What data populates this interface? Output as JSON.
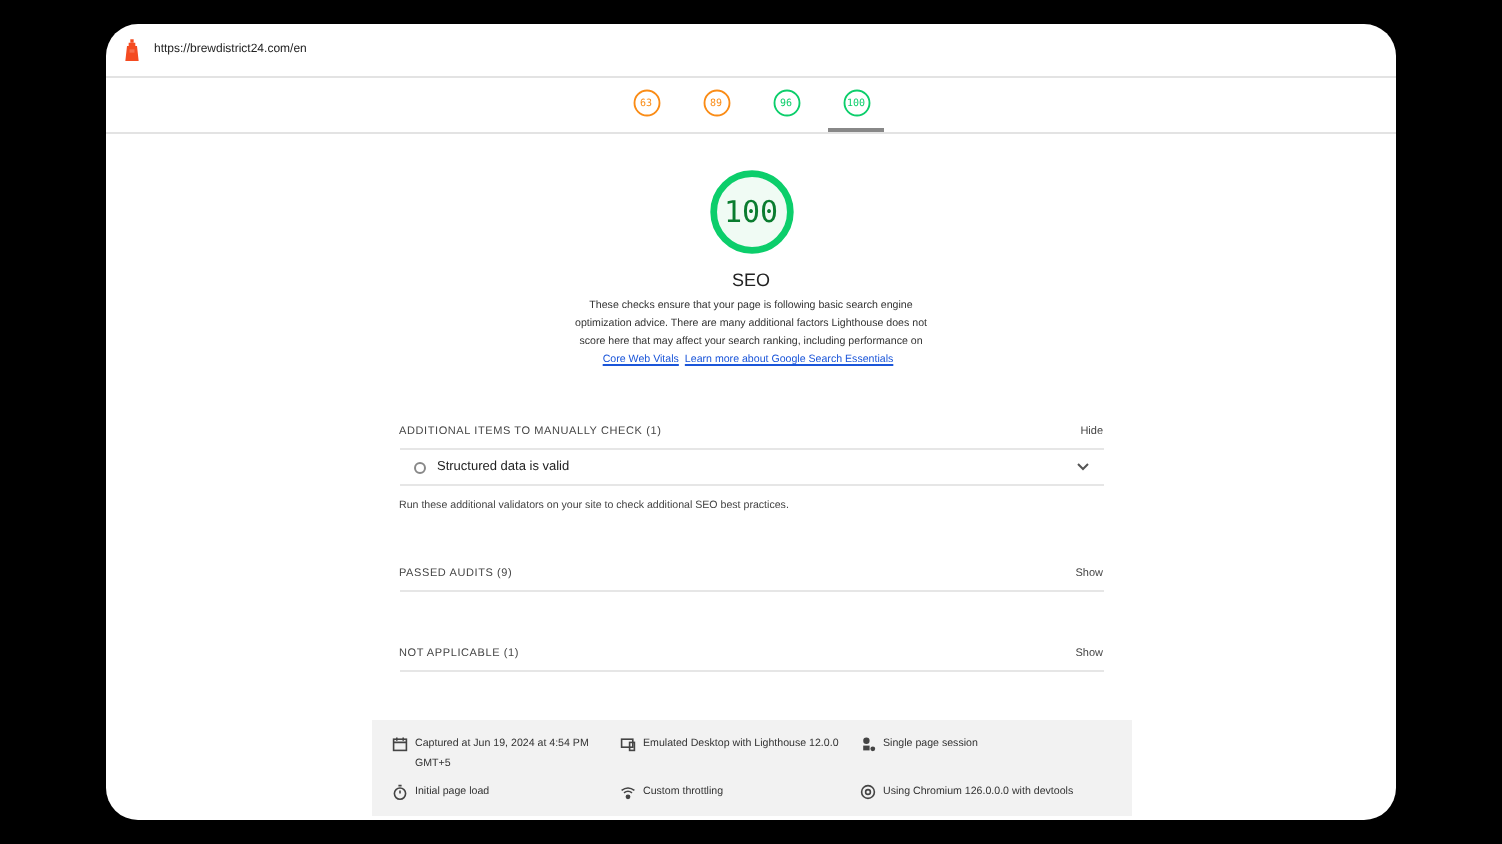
{
  "address_bar": {
    "url": "https://brewdistrict24.com/en"
  },
  "score_tabs": [
    {
      "score": "63",
      "color": "#fa8c16",
      "selected": false
    },
    {
      "score": "89",
      "color": "#fa8c16",
      "selected": false
    },
    {
      "score": "96",
      "color": "#0cce6b",
      "selected": false
    },
    {
      "score": "100",
      "color": "#0cce6b",
      "selected": true
    }
  ],
  "category": {
    "score": "100",
    "title": "SEO",
    "description": "These checks ensure that your page is following basic search engine optimization advice. There are many additional factors Lighthouse does not score here that may affect your search ranking, including performance on",
    "links": [
      "Core Web Vitals",
      "Learn more about Google Search Essentials"
    ]
  },
  "groups": [
    {
      "title": "ADDITIONAL ITEMS TO MANUALLY CHECK (1)",
      "toggle": "Hide",
      "items": [
        {
          "label": "Structured data is valid"
        }
      ],
      "note": "Run these additional validators on your site to check additional SEO best practices."
    },
    {
      "title": "PASSED AUDITS (9)",
      "toggle": "Show"
    },
    {
      "title": "NOT APPLICABLE (1)",
      "toggle": "Show"
    }
  ],
  "footer": [
    {
      "kind": "calendar",
      "text": "Captured at Jun 19, 2024 at 4:54 PM GMT+5"
    },
    {
      "kind": "desktop",
      "text": "Emulated Desktop with Lighthouse 12.0.0"
    },
    {
      "kind": "session",
      "text": "Single page session"
    },
    {
      "kind": "timer",
      "text": "Initial page load"
    },
    {
      "kind": "throttle",
      "text": "Custom throttling"
    },
    {
      "kind": "browser",
      "text": "Using Chromium 126.0.0.0 with devtools"
    }
  ]
}
